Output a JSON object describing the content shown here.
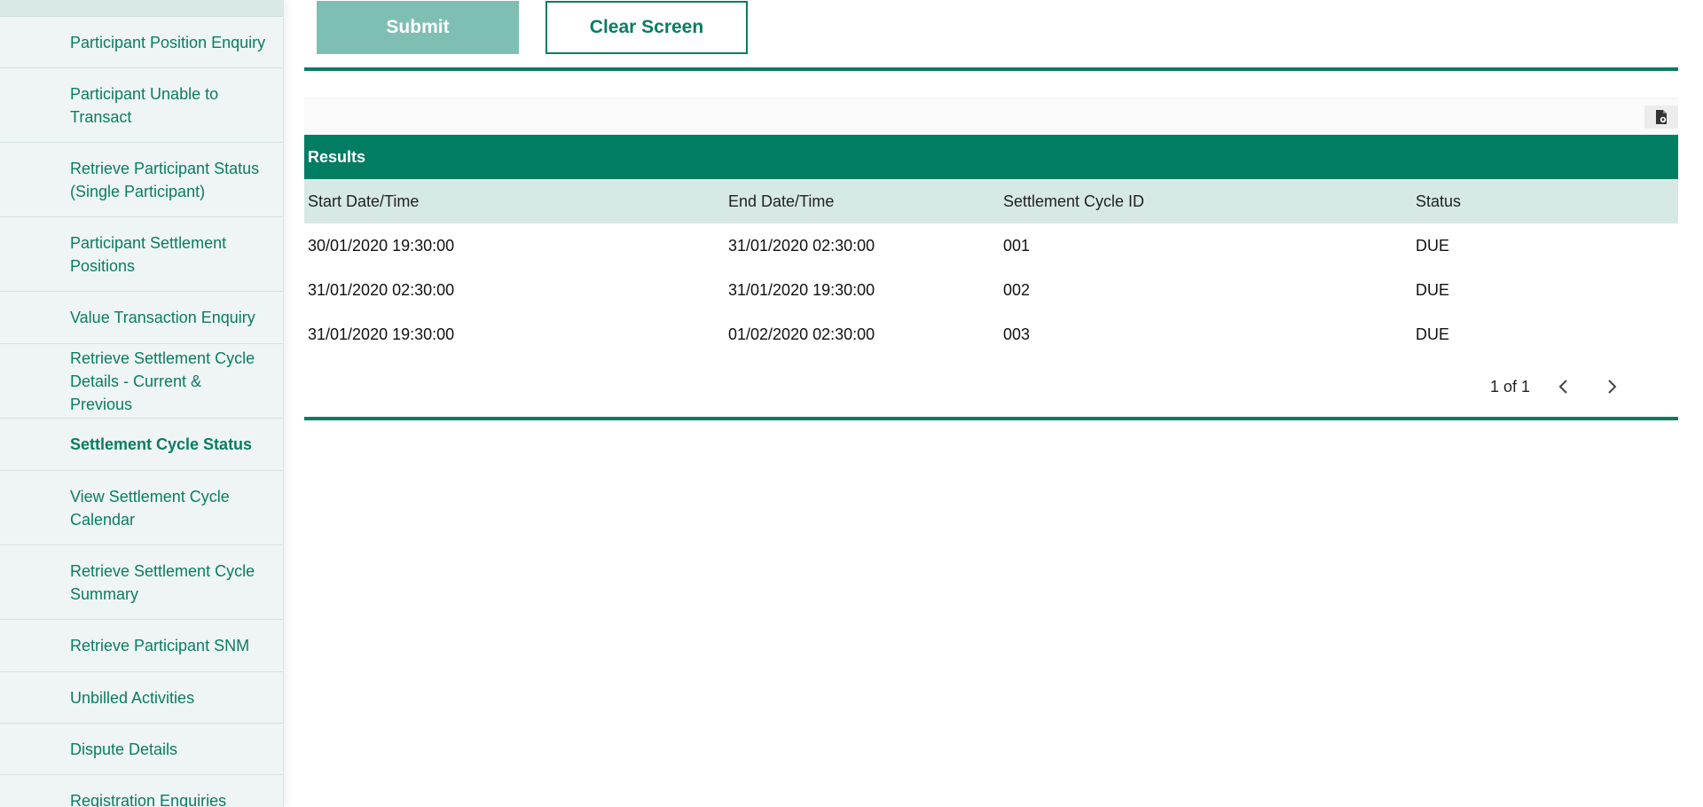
{
  "sidebar": {
    "items": [
      {
        "label": "Participant Position Enquiry"
      },
      {
        "label": "Participant Unable to Transact"
      },
      {
        "label": "Retrieve Participant Status (Single Participant)"
      },
      {
        "label": "Participant Settlement Positions"
      },
      {
        "label": "Value Transaction Enquiry"
      },
      {
        "label": "Retrieve Settlement Cycle Details - Current & Previous"
      },
      {
        "label": "Settlement Cycle Status",
        "active": true
      },
      {
        "label": "View Settlement Cycle Calendar"
      },
      {
        "label": "Retrieve Settlement Cycle Summary"
      },
      {
        "label": "Retrieve Participant SNM"
      },
      {
        "label": "Unbilled Activities"
      },
      {
        "label": "Dispute Details"
      },
      {
        "label": "Registration Enquiries"
      }
    ]
  },
  "actions": {
    "submit_label": "Submit",
    "clear_label": "Clear Screen"
  },
  "export": {
    "icon": "export-document-icon"
  },
  "results": {
    "title": "Results",
    "columns": [
      "Start Date/Time",
      "End Date/Time",
      "Settlement Cycle ID",
      "Status"
    ],
    "rows": [
      [
        "30/01/2020 19:30:00",
        "31/01/2020 02:30:00",
        "001",
        "DUE"
      ],
      [
        "31/01/2020 02:30:00",
        "31/01/2020 19:30:00",
        "002",
        "DUE"
      ],
      [
        "31/01/2020 19:30:00",
        "01/02/2020 02:30:00",
        "003",
        "DUE"
      ]
    ]
  },
  "pagination": {
    "label": "1 of 1",
    "prev_icon": "chevron-left-icon",
    "next_icon": "chevron-right-icon"
  },
  "colors": {
    "brand": "#007d63",
    "submit_bg": "#7fbfb3",
    "table_header_bg": "#d6e9e5",
    "sidebar_bg": "#eef5f4"
  }
}
